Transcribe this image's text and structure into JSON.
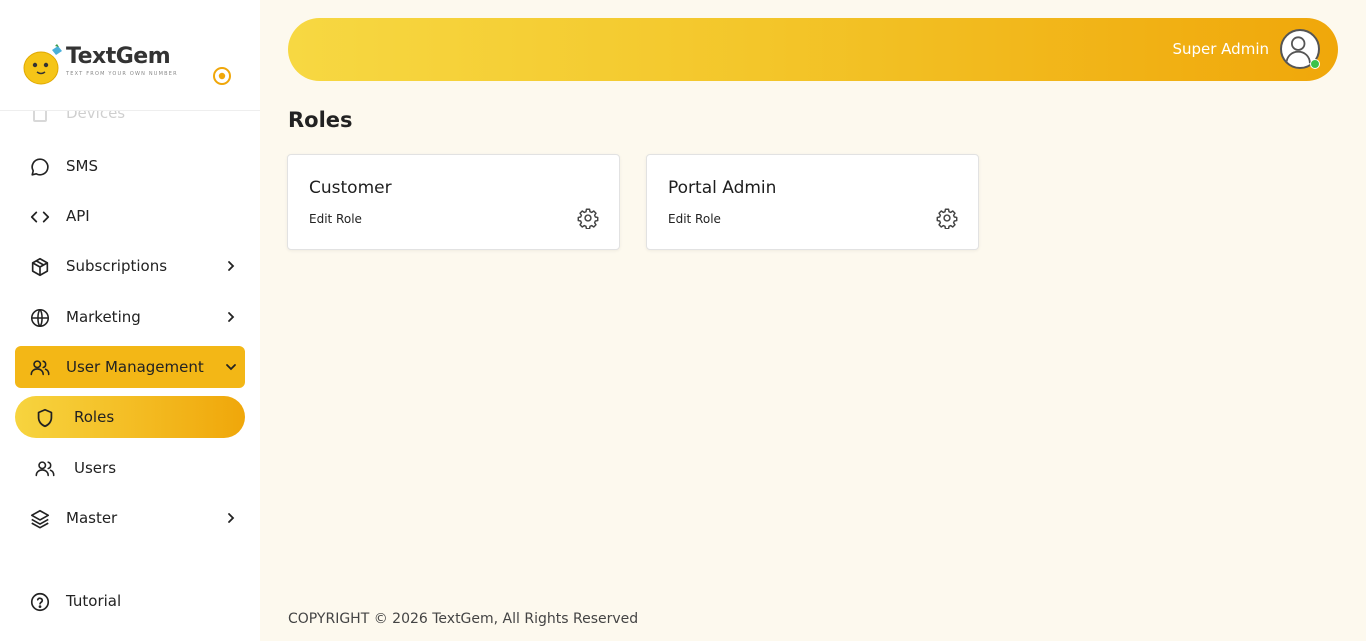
{
  "brand": {
    "name": "TextGem",
    "tagline": "TEXT FROM YOUR OWN NUMBER",
    "accent": "#f3b716"
  },
  "sidebar": {
    "partial_item": {
      "label": "Devices",
      "icon": "device-icon"
    },
    "items": [
      {
        "label": "SMS",
        "icon": "chat-icon"
      },
      {
        "label": "API",
        "icon": "code-icon"
      },
      {
        "label": "Subscriptions",
        "icon": "box-icon",
        "has_children": true
      },
      {
        "label": "Marketing",
        "icon": "globe-icon",
        "has_children": true
      },
      {
        "label": "User Management",
        "icon": "users-icon",
        "expanded": true
      },
      {
        "label": "Roles",
        "icon": "shield-icon",
        "active": true
      },
      {
        "label": "Users",
        "icon": "users-icon"
      },
      {
        "label": "Master",
        "icon": "layers-icon",
        "has_children": true
      },
      {
        "label": "Tutorial",
        "icon": "help-circle-icon"
      }
    ]
  },
  "header": {
    "user_name": "Super Admin",
    "status": "online"
  },
  "main": {
    "title": "Roles",
    "roles": [
      {
        "name": "Customer",
        "action": "Edit Role"
      },
      {
        "name": "Portal Admin",
        "action": "Edit Role"
      }
    ]
  },
  "footer": {
    "text": "COPYRIGHT © 2026 TextGem, All Rights Reserved"
  }
}
